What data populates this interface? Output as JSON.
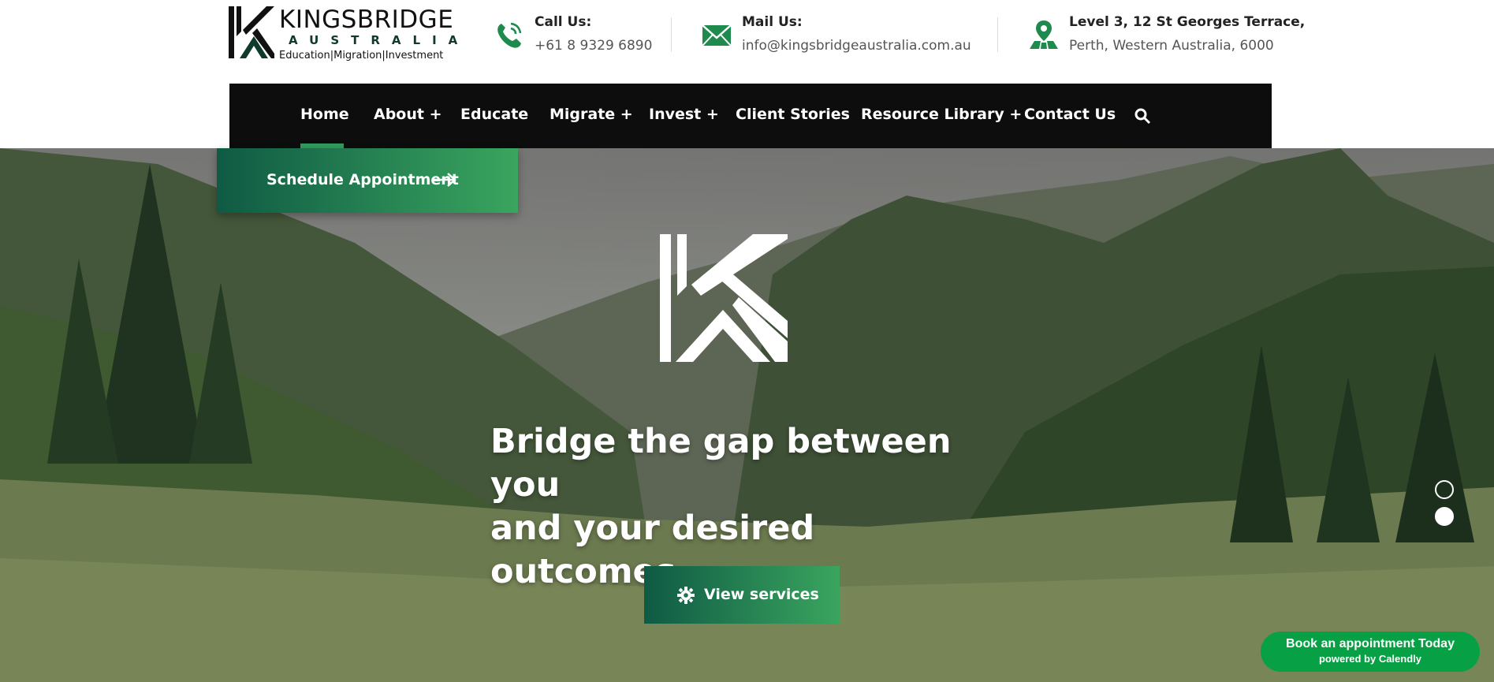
{
  "brand": {
    "name": "KINGSBRIDGE",
    "subtitle": "AUSTRALIA",
    "tagline": "Education|Migration|Investment"
  },
  "contact": {
    "call": {
      "label": "Call Us:",
      "value": "+61 8 9329 6890",
      "icon": "phone-icon"
    },
    "mail": {
      "label": "Mail Us:",
      "value": "info@kingsbridgeaustralia.com.au",
      "icon": "mail-icon"
    },
    "address": {
      "label": "Level 3, 12 St Georges Terrace,",
      "value": "Perth, Western Australia, 6000",
      "icon": "location-icon"
    }
  },
  "nav": {
    "items": [
      {
        "label": "Home",
        "active": true
      },
      {
        "label": "About +"
      },
      {
        "label": "Educate"
      },
      {
        "label": "Migrate +"
      },
      {
        "label": "Invest +"
      },
      {
        "label": "Client Stories"
      },
      {
        "label": "Resource Library +"
      },
      {
        "label": "Contact Us"
      }
    ],
    "search_icon": "search-icon"
  },
  "hero": {
    "schedule_label": "Schedule Appointment",
    "headline_line1": "Bridge the gap between you",
    "headline_line2": "and your desired outcomes.",
    "cta_label": "View services",
    "slide_count": 2,
    "active_slide": 2
  },
  "calendly": {
    "title": "Book an appointment Today",
    "subtitle": "powered by Calendly",
    "color": "#08a045"
  },
  "colors": {
    "accent_dark": "#0f5a44",
    "accent_light": "#3aa55f",
    "nav_bg": "#0d0d0d"
  }
}
